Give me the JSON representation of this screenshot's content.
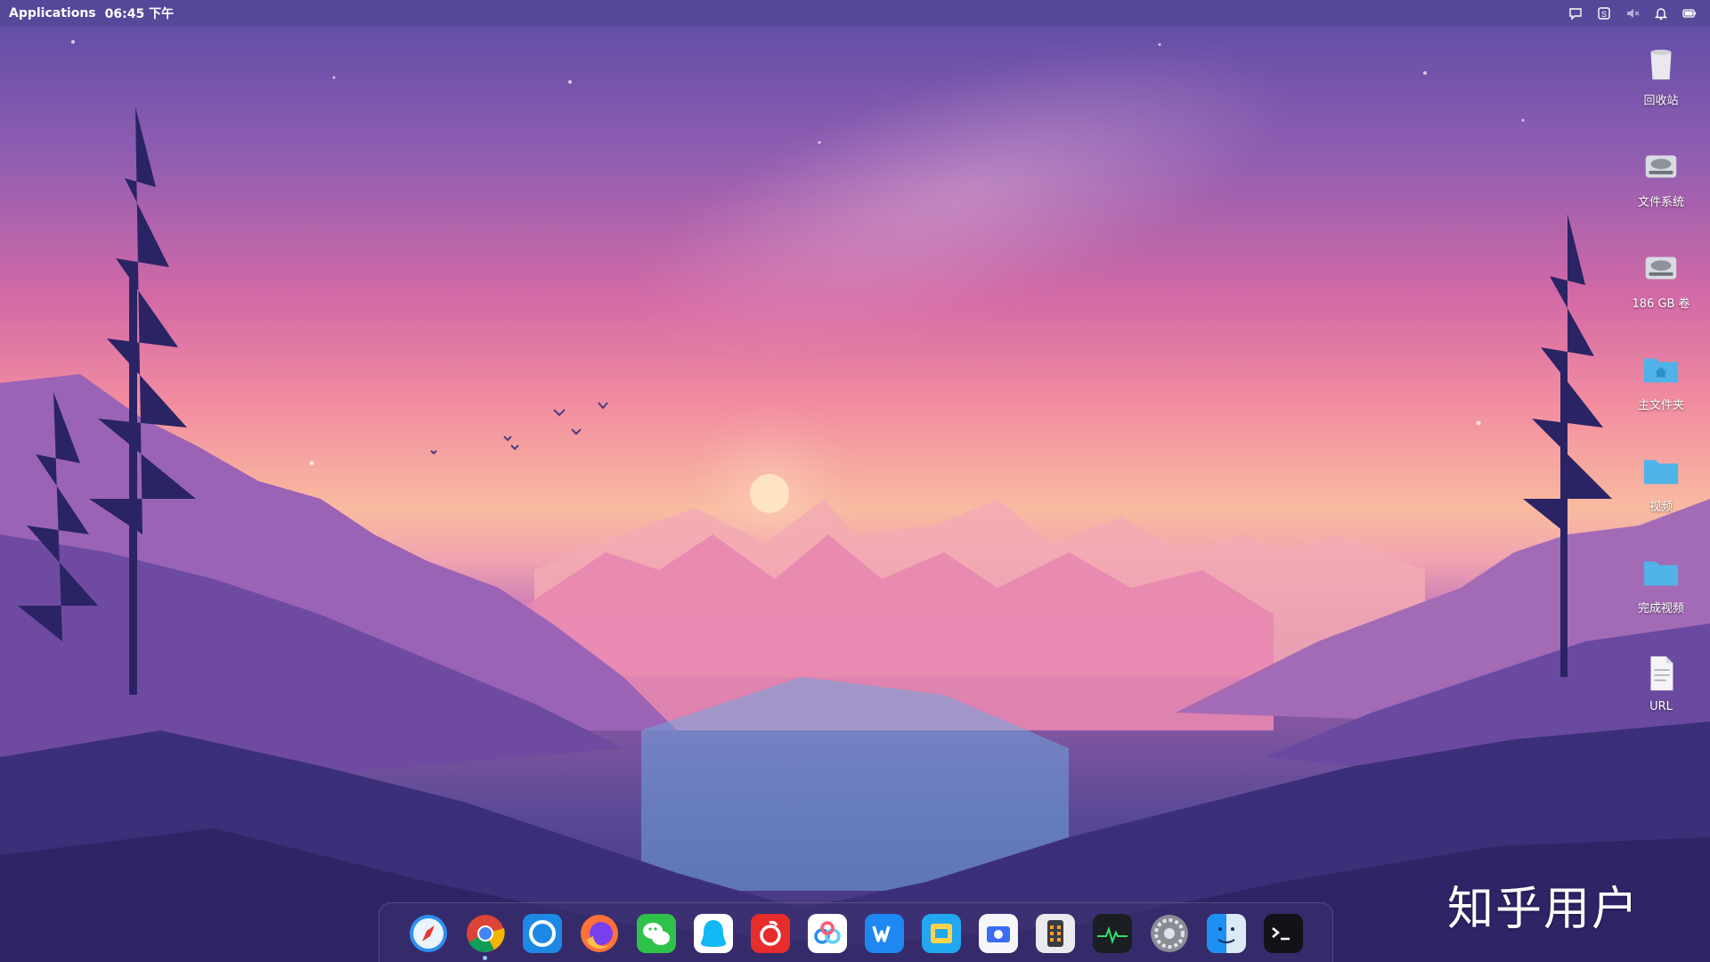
{
  "top_panel": {
    "applications_label": "Applications",
    "clock": "06:45 下午",
    "tray_icons": [
      "chat-bubble-icon",
      "s-app-icon",
      "volume-muted-icon",
      "notification-bell-icon",
      "battery-icon"
    ]
  },
  "desktop_icons": [
    {
      "label": "回收站",
      "icon": "trash-icon"
    },
    {
      "label": "文件系统",
      "icon": "drive-icon"
    },
    {
      "label": "186 GB 卷",
      "icon": "drive-icon"
    },
    {
      "label": "主文件夹",
      "icon": "home-folder-icon"
    },
    {
      "label": "视频",
      "icon": "folder-icon"
    },
    {
      "label": "完成视频",
      "icon": "folder-icon"
    },
    {
      "label": "URL",
      "icon": "document-icon"
    }
  ],
  "dock": {
    "apps": [
      "safari-icon",
      "chrome-icon",
      "browser-icon",
      "firefox-icon",
      "wechat-icon",
      "qq-icon",
      "netease-music-icon",
      "baidu-netdisk-icon",
      "wps-icon",
      "file-manager-icon",
      "screenshot-icon",
      "calculator-icon",
      "system-monitor-icon",
      "settings-icon",
      "finder-icon",
      "terminal-icon"
    ],
    "running": [
      "chrome-icon"
    ]
  },
  "watermark": {
    "text": "知乎用户"
  },
  "colors": {
    "panel": "#5646969",
    "accent": "#9cc7ff"
  }
}
